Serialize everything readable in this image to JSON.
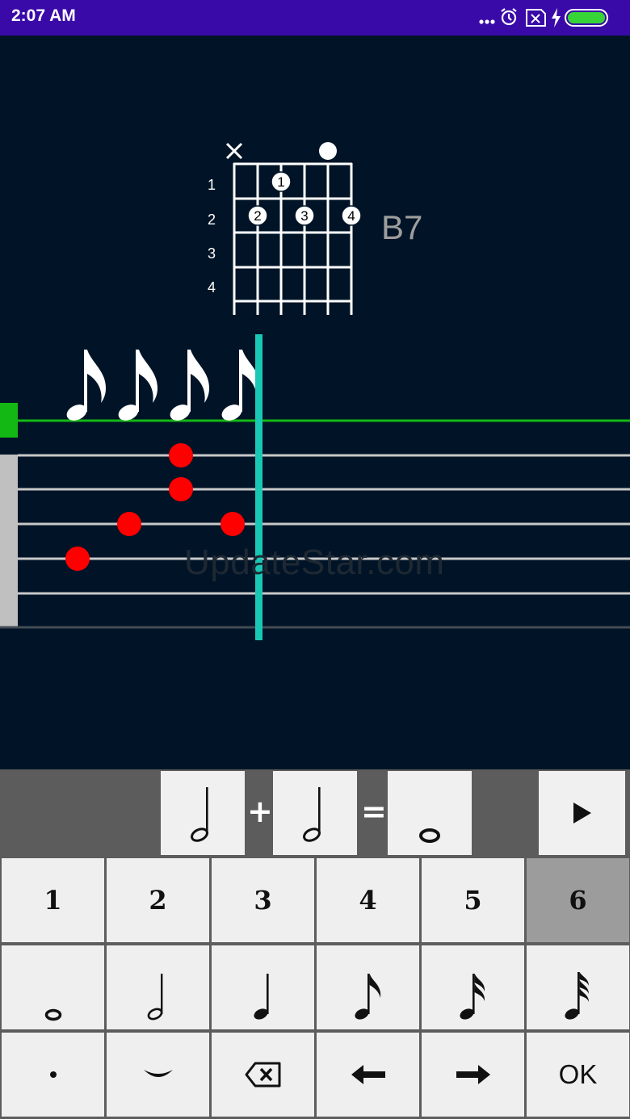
{
  "status_bar": {
    "time": "2:07 AM",
    "icons": [
      "more-dots-icon",
      "alarm-icon",
      "sim-x-icon",
      "charging-icon",
      "battery-icon"
    ]
  },
  "chord": {
    "name": "B7",
    "fret_labels": [
      "1",
      "2",
      "3",
      "4"
    ],
    "string_markers": [
      "x",
      "",
      "",
      "",
      "o",
      ""
    ],
    "finger_dots": [
      {
        "string": 3,
        "fret": 1,
        "finger": "1"
      },
      {
        "string": 2,
        "fret": 2,
        "finger": "2"
      },
      {
        "string": 4,
        "fret": 2,
        "finger": "3"
      },
      {
        "string": 6,
        "fret": 2,
        "finger": "4"
      }
    ]
  },
  "tab": {
    "notes": [
      "eighth",
      "eighth",
      "eighth",
      "eighth"
    ],
    "note_dots": [
      {
        "note": 1,
        "string": 4
      },
      {
        "note": 2,
        "string": 3
      },
      {
        "note": 3,
        "string": 1
      },
      {
        "note": 3,
        "string": 2
      },
      {
        "note": 4,
        "string": 3
      }
    ],
    "colors": {
      "rhythm_line": "#14b814",
      "cursor": "#19c8b4",
      "dot": "#ff0000",
      "string": "#c8c8c8"
    }
  },
  "watermark": "UpdateStar.com",
  "formula": {
    "operand1": "half-note",
    "plus": "+",
    "operand2": "half-note",
    "equals": "=",
    "result": "whole-note"
  },
  "keys": {
    "numbers": [
      "1",
      "2",
      "3",
      "4",
      "5",
      "6"
    ],
    "selected_number": "6",
    "durations": [
      "whole-note",
      "half-note",
      "quarter-note",
      "eighth-note",
      "sixteenth-note",
      "thirtysecond-note"
    ],
    "ok_label": "OK"
  },
  "colors": {
    "background": "#011427",
    "status_bar": "#3a0aa8",
    "panel": "#5c5c5c",
    "key": "#efefef",
    "key_selected": "#9c9c9c"
  }
}
